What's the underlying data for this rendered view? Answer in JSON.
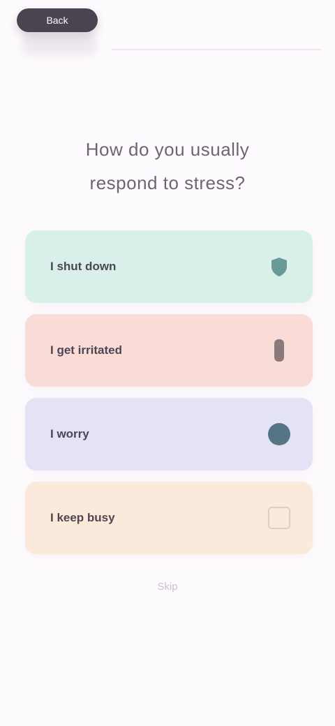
{
  "header": {
    "back_label": "Back"
  },
  "heading": {
    "line1": "How do you usually",
    "line2": "respond to stress?"
  },
  "options": [
    {
      "label": "I shut down",
      "icon": "shield-icon",
      "color": "#d9efea"
    },
    {
      "label": "I get irritated",
      "icon": "bolt-icon",
      "color": "#f9dcd8"
    },
    {
      "label": "I worry",
      "icon": "cloud-icon",
      "color": "#e3e3f5"
    },
    {
      "label": "I keep busy",
      "icon": "clock-icon",
      "color": "#fbeadb"
    }
  ],
  "footer": {
    "skip_label": "Skip"
  }
}
